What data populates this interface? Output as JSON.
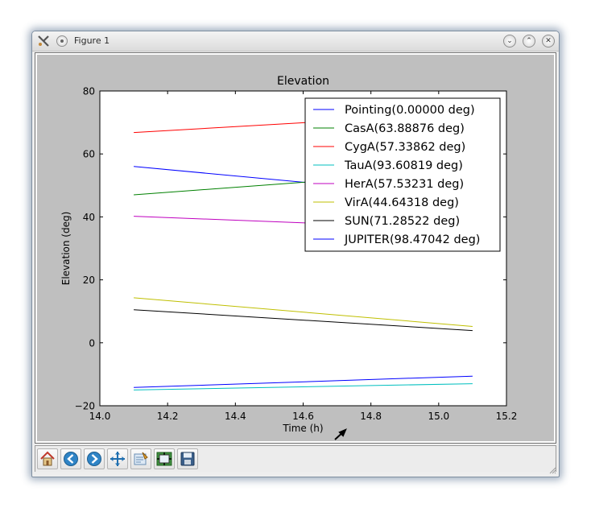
{
  "window": {
    "title": "Figure 1",
    "close_glyph": "✕",
    "maximize_glyph": "⌃",
    "minimize_glyph": "⌄"
  },
  "toolbar": [
    {
      "name": "home-button",
      "icon": "home-icon"
    },
    {
      "name": "back-button",
      "icon": "arrow-left-icon"
    },
    {
      "name": "forward-button",
      "icon": "arrow-right-icon"
    },
    {
      "name": "pan-button",
      "icon": "move-icon"
    },
    {
      "name": "zoom-button",
      "icon": "zoom-rect-icon"
    },
    {
      "name": "subplots-button",
      "icon": "subplots-icon"
    },
    {
      "name": "save-button",
      "icon": "floppy-icon"
    }
  ],
  "chart_data": {
    "type": "line",
    "title": "Elevation",
    "xlabel": "Time (h)",
    "ylabel": "Elevation (deg)",
    "xlim": [
      14.0,
      15.2
    ],
    "ylim": [
      -20,
      80
    ],
    "xticks": [
      "14.0",
      "14.2",
      "14.4",
      "14.6",
      "14.8",
      "15.0",
      "15.2"
    ],
    "yticks": [
      "−20",
      "0",
      "20",
      "40",
      "60",
      "80"
    ],
    "xtick_values": [
      14.0,
      14.2,
      14.4,
      14.6,
      14.8,
      15.0,
      15.2
    ],
    "ytick_values": [
      -20,
      0,
      20,
      40,
      60,
      80
    ],
    "grid": false,
    "legend_position": "top-right",
    "series": [
      {
        "name": "Pointing(0.00000 deg)",
        "color": "#0000ff",
        "x": [
          14.1,
          15.1
        ],
        "y": [
          56,
          46
        ]
      },
      {
        "name": "CasA(63.88876 deg)",
        "color": "#008000",
        "x": [
          14.1,
          15.1
        ],
        "y": [
          47,
          55
        ]
      },
      {
        "name": "CygA(57.33862 deg)",
        "color": "#ff0000",
        "x": [
          14.1,
          15.1
        ],
        "y": [
          66.8,
          73
        ]
      },
      {
        "name": "TauA(93.60819 deg)",
        "color": "#00bfbf",
        "x": [
          14.1,
          15.1
        ],
        "y": [
          -15,
          -13
        ]
      },
      {
        "name": "HerA(57.53231 deg)",
        "color": "#bf00bf",
        "x": [
          14.1,
          15.1
        ],
        "y": [
          40.2,
          36
        ]
      },
      {
        "name": "VirA(44.64318 deg)",
        "color": "#bfbf00",
        "x": [
          14.1,
          15.1
        ],
        "y": [
          14.3,
          5.2
        ]
      },
      {
        "name": "SUN(71.28522 deg)",
        "color": "#000000",
        "x": [
          14.1,
          15.1
        ],
        "y": [
          10.5,
          3.9
        ]
      },
      {
        "name": "JUPITER(98.47042 deg)",
        "color": "#0000ff",
        "x": [
          14.1,
          15.1
        ],
        "y": [
          -14.2,
          -10.6
        ]
      }
    ]
  }
}
